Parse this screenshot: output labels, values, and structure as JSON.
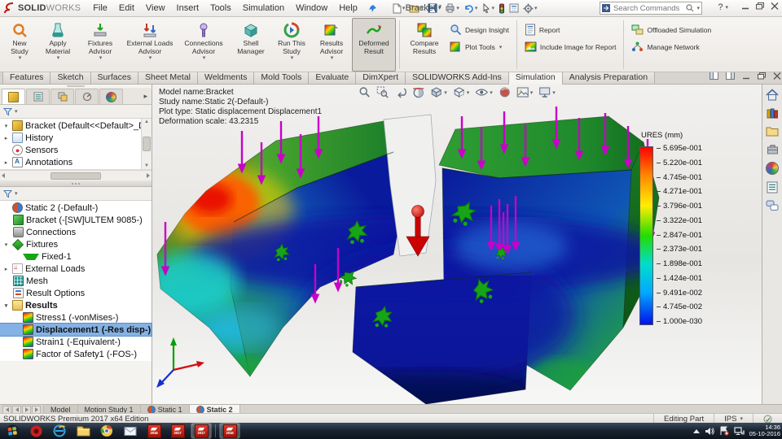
{
  "window": {
    "brand_a": "SOLID",
    "brand_b": "WORKS",
    "title": "Bracket *",
    "search_placeholder": "Search Commands",
    "help": "?"
  },
  "menubar": {
    "items": [
      "File",
      "Edit",
      "View",
      "Insert",
      "Tools",
      "Simulation",
      "Window",
      "Help"
    ]
  },
  "qat_icons": [
    "new",
    "open",
    "save",
    "print",
    "undo",
    "select",
    "rebuild",
    "file-properties",
    "options"
  ],
  "ribbon": {
    "buttons": [
      {
        "label": "New Study",
        "dropdown": true
      },
      {
        "label": "Apply Material",
        "dropdown": true
      },
      {
        "label": "Fixtures Advisor",
        "dropdown": true
      },
      {
        "label": "External Loads Advisor",
        "dropdown": true
      },
      {
        "label": "Connections Advisor",
        "dropdown": true
      },
      {
        "label": "Shell Manager",
        "dropdown": false
      },
      {
        "label": "Run This Study",
        "dropdown": true
      },
      {
        "label": "Results Advisor",
        "dropdown": true
      },
      {
        "label": "Deformed Result",
        "dropdown": false,
        "active": true
      },
      {
        "label": "Compare Results",
        "dropdown": false
      }
    ],
    "stacked": [
      {
        "label": "Design Insight"
      },
      {
        "label": "Plot Tools",
        "dropdown": true
      },
      {
        "label": "Report"
      },
      {
        "label": "Include Image for Report"
      },
      {
        "label": "Offloaded Simulation"
      },
      {
        "label": "Manage Network"
      }
    ]
  },
  "cad_tabs": {
    "items": [
      "Features",
      "Sketch",
      "Surfaces",
      "Sheet Metal",
      "Weldments",
      "Mold Tools",
      "Evaluate",
      "DimXpert",
      "SOLIDWORKS Add-Ins",
      "Simulation",
      "Analysis Preparation"
    ],
    "active": "Simulation"
  },
  "feature_tree": {
    "root": "Bracket (Default<<Default>_Display St",
    "items": [
      "History",
      "Sensors",
      "Annotations"
    ]
  },
  "study_tree": {
    "items": [
      {
        "label": "Static 2 (-Default-)"
      },
      {
        "label": "Bracket (-[SW]ULTEM 9085-)"
      },
      {
        "label": "Connections"
      },
      {
        "label": "Fixtures"
      },
      {
        "label": "Fixed-1"
      },
      {
        "label": "External Loads"
      },
      {
        "label": "Mesh"
      },
      {
        "label": "Result Options"
      },
      {
        "label": "Results"
      },
      {
        "label": "Stress1 (-vonMises-)"
      },
      {
        "label": "Displacement1 (-Res disp-)",
        "selected": true
      },
      {
        "label": "Strain1 (-Equivalent-)"
      },
      {
        "label": "Factor of Safety1 (-FOS-)"
      }
    ]
  },
  "viewport": {
    "info_lines": [
      "Model name:Bracket",
      "Study name:Static 2(-Default-)",
      "Plot type: Static displacement Displacement1",
      "Deformation scale: 43.2315"
    ],
    "legend": {
      "title": "URES (mm)",
      "values": [
        "5.695e-001",
        "5.220e-001",
        "4.745e-001",
        "4.271e-001",
        "3.796e-001",
        "3.322e-001",
        "2.847e-001",
        "2.373e-001",
        "1.898e-001",
        "1.424e-001",
        "9.491e-002",
        "4.745e-002",
        "1.000e-030"
      ]
    },
    "hud_icons": [
      "zoom-to-fit",
      "zoom-to-area",
      "previous-view",
      "section-view",
      "view-orientation",
      "display-style",
      "hide-show-items",
      "edit-appearance",
      "apply-scene",
      "view-settings"
    ]
  },
  "taskpane_icons": [
    "home",
    "design-library",
    "file-explorer",
    "toolbox",
    "appearances",
    "custom-properties",
    "forum"
  ],
  "bottom_tabs": {
    "items": [
      "Model",
      "Motion Study 1",
      "Static 1",
      "Static 2"
    ],
    "active": "Static 2"
  },
  "status_bar": {
    "left": "SOLIDWORKS Premium 2017 x64 Edition",
    "mode": "Editing Part",
    "units": "IPS"
  },
  "taskbar": {
    "app_icons": [
      "start",
      "red-app",
      "internet-explorer",
      "file-explorer",
      "chrome",
      "mail"
    ],
    "sw_badges": [
      "2016",
      "2017",
      "2017",
      "2016"
    ],
    "tray_icons": [
      "show-hidden",
      "volume",
      "action-center",
      "network"
    ],
    "clock_time": "14:36",
    "clock_date": "05-10-2016"
  },
  "colors": {
    "selection": "#84b2e4",
    "load_arrow": "#c800c8",
    "fixture_symbol": "#17a517",
    "pin": "#cc0202",
    "legend_top": "#ff0000",
    "legend_bottom": "#0011ee",
    "taskbar_bg": "#1b2532"
  }
}
